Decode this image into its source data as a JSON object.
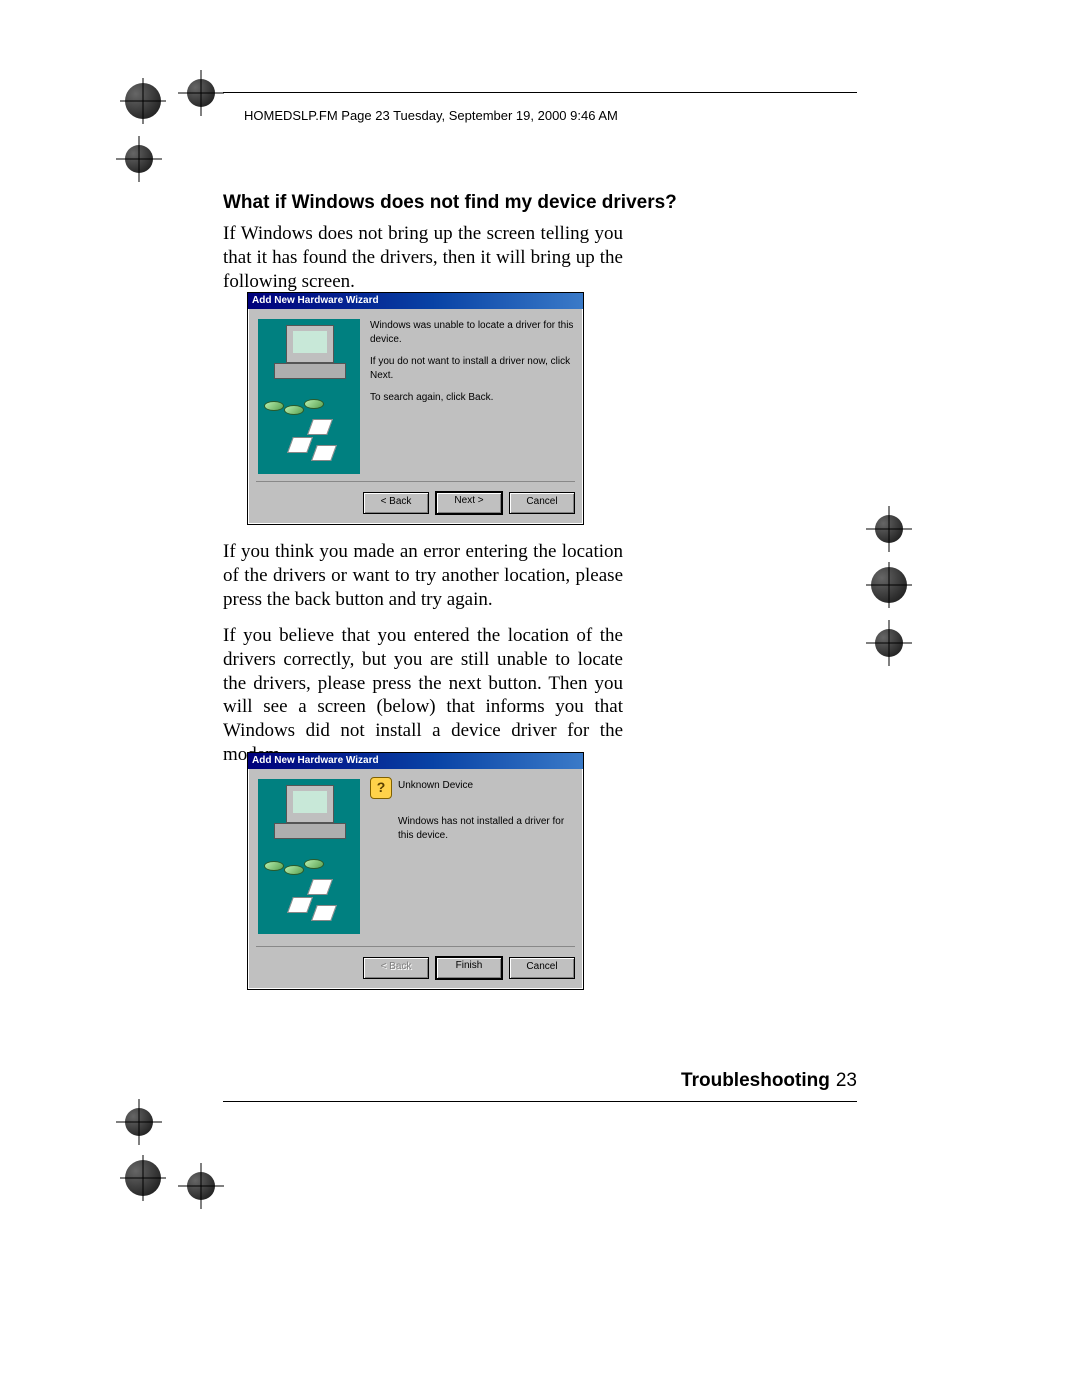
{
  "header": "HOMEDSLP.FM  Page 23  Tuesday, September 19, 2000  9:46 AM",
  "heading": "What if Windows does not find my device drivers?",
  "para1": "If Windows does not bring up the screen telling you that it has found the drivers, then it will bring up the following screen.",
  "para2": "If you think you made an error entering the location of the drivers or want to try another location, please press the back button and try again.",
  "para3": "If you believe that you entered the location of the drivers correctly, but you are still unable to locate the drivers, please press the next button. Then you will see a screen (below) that informs you that Windows did not install a device driver for the modem.",
  "footer": {
    "section": "Troubleshooting",
    "page": "23"
  },
  "dialog1": {
    "title": "Add New Hardware Wizard",
    "line1": "Windows was unable to locate a driver for this device.",
    "line2": "If you do not want to install a driver now, click Next.",
    "line3": "To search again, click Back.",
    "back": "< Back",
    "next": "Next >",
    "cancel": "Cancel"
  },
  "dialog2": {
    "title": "Add New Hardware Wizard",
    "device": "Unknown Device",
    "line1": "Windows has not installed a driver for this device.",
    "back": "< Back",
    "finish": "Finish",
    "cancel": "Cancel"
  }
}
